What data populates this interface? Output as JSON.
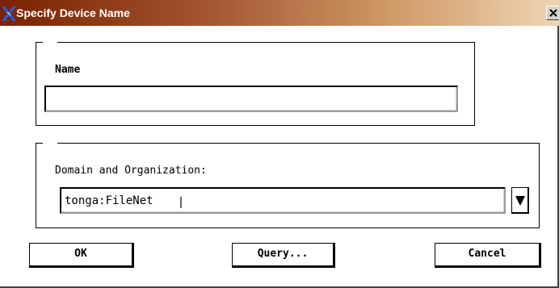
{
  "window": {
    "title": "Specify Device Name",
    "close_glyph": "✕"
  },
  "name_group": {
    "label": "Name",
    "value": "",
    "placeholder": ""
  },
  "domain_group": {
    "label": "Domain and Organization:",
    "value": "tonga:FileNet",
    "dropdown_icon": "triangle-down-icon"
  },
  "buttons": {
    "ok_label": "OK",
    "query_label": "Query...",
    "cancel_label": "Cancel"
  },
  "colors": {
    "titlebar_start": "#7a2200",
    "titlebar_end": "#efd5b4",
    "icon_blue": "#1f5fe0"
  }
}
